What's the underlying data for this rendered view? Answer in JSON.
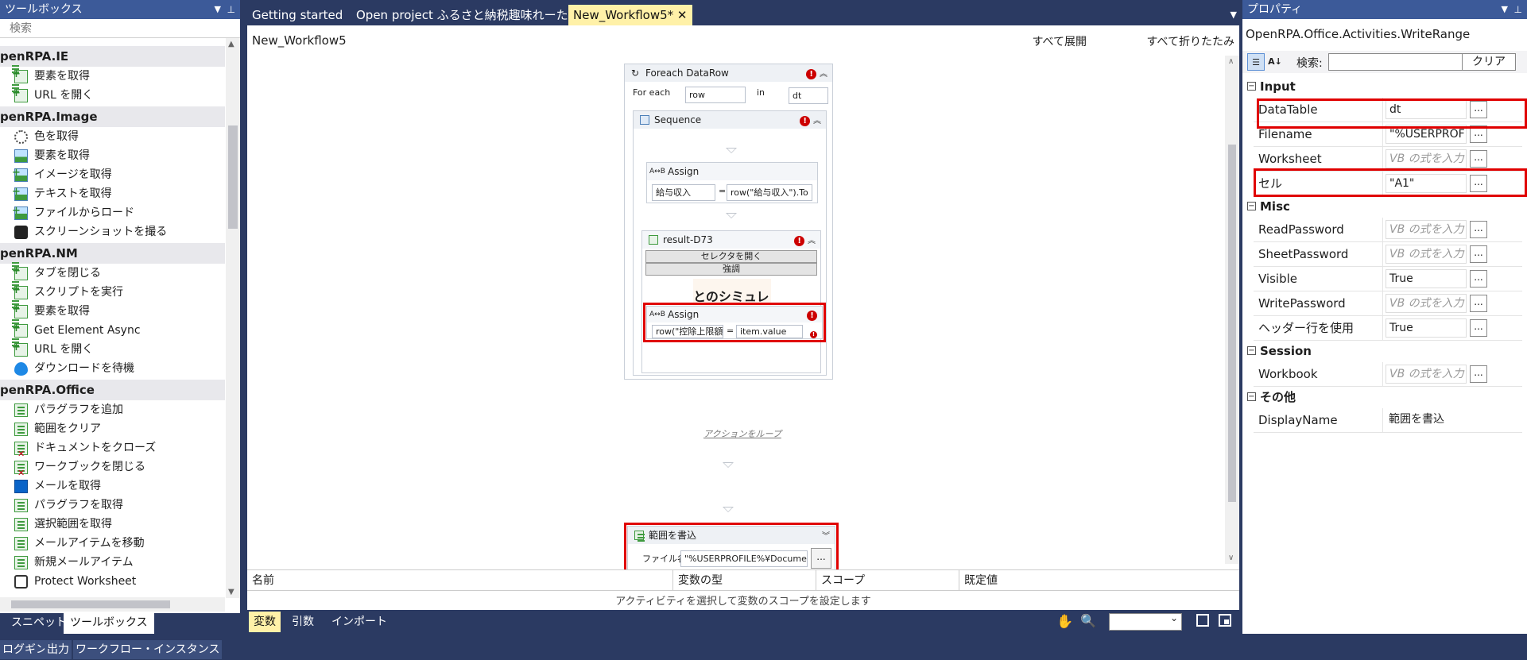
{
  "toolbox": {
    "title": "ツールボックス",
    "search_placeholder": "検索",
    "categories": [
      {
        "name": "penRPA.IE",
        "items": [
          "要素を取得",
          "URL を開く"
        ]
      },
      {
        "name": "penRPA.Image",
        "items": [
          "色を取得",
          "要素を取得",
          "イメージを取得",
          "テキストを取得",
          "ファイルからロード",
          "スクリーンショットを撮る"
        ]
      },
      {
        "name": "penRPA.NM",
        "items": [
          "タブを閉じる",
          "スクリプトを実行",
          "要素を取得",
          "Get Element Async",
          "URL を開く",
          "ダウンロードを待機"
        ]
      },
      {
        "name": "penRPA.Office",
        "items": [
          "パラグラフを追加",
          "範囲をクリア",
          "ドキュメントをクローズ",
          "ワークブックを閉じる",
          "メールを取得",
          "パラグラフを取得",
          "選択範囲を取得",
          "メールアイテムを移動",
          "新規メールアイテム",
          "Protect Worksheet"
        ]
      }
    ],
    "tabs": [
      "スニペット",
      "ツールボックス"
    ]
  },
  "doc_tabs": [
    "Getting started",
    "Open project  ふるさと納税趣味れーた*",
    "New_Workflow5*"
  ],
  "designer": {
    "title": "New_Workflow5",
    "expand_all": "すべて展開",
    "collapse_all": "すべて折りたたみ",
    "foreach": {
      "title": "Foreach DataRow",
      "for_each": "For each",
      "item": "row",
      "in": "in",
      "source": "dt"
    },
    "sequence": {
      "title": "Sequence"
    },
    "assign1": {
      "title": "Assign",
      "to": "給与収入",
      "value": "row(\"給与収入\").To"
    },
    "result": {
      "title": "result-D73",
      "open_selector": "セレクタを開く",
      "highlight": "強調",
      "preview_text": "とのシミュレ"
    },
    "assign2": {
      "title": "Assign",
      "to": "row(\"控除上限額（",
      "value": "item.value"
    },
    "loop_action": "アクションをループ",
    "write_range": {
      "title": "範囲を書込",
      "file_label": "ファイル名",
      "file_value": "\"%USERPROFILE%¥Documents¥"
    }
  },
  "variables": {
    "columns": [
      "名前",
      "変数の型",
      "スコープ",
      "既定値"
    ],
    "hint": "アクティビティを選択して変数のスコープを設定します",
    "tabs": [
      "変数",
      "引数",
      "インポート"
    ]
  },
  "status_tabs": [
    "ログギング",
    "出力",
    "ワークフロー・インスタンス"
  ],
  "properties": {
    "title": "プロパティ",
    "type": "OpenRPA.Office.Activities.WriteRange",
    "search_label": "検索:",
    "clear": "クリア",
    "categories": [
      {
        "name": "Input",
        "rows": [
          {
            "name": "DataTable",
            "value": "dt",
            "placeholder": false,
            "button": true
          },
          {
            "name": "Filename",
            "value": "\"%USERPROFI",
            "placeholder": false,
            "button": true
          },
          {
            "name": "Worksheet",
            "value": "VB の式を入力",
            "placeholder": true,
            "button": true
          },
          {
            "name": "セル",
            "value": "\"A1\"",
            "placeholder": false,
            "button": true
          }
        ]
      },
      {
        "name": "Misc",
        "rows": [
          {
            "name": "ReadPassword",
            "value": "VB の式を入力",
            "placeholder": true,
            "button": true
          },
          {
            "name": "SheetPassword",
            "value": "VB の式を入力",
            "placeholder": true,
            "button": true
          },
          {
            "name": "Visible",
            "value": "True",
            "placeholder": false,
            "button": true
          },
          {
            "name": "WritePassword",
            "value": "VB の式を入力",
            "placeholder": true,
            "button": true
          },
          {
            "name": "ヘッダー行を使用",
            "value": "True",
            "placeholder": false,
            "button": true
          }
        ]
      },
      {
        "name": "Session",
        "rows": [
          {
            "name": "Workbook",
            "value": "VB の式を入力",
            "placeholder": true,
            "button": true
          }
        ]
      },
      {
        "name": "その他",
        "rows": [
          {
            "name": "DisplayName",
            "value": "範囲を書込",
            "placeholder": false,
            "button": false
          }
        ]
      }
    ]
  },
  "colors": {
    "chrome": "#2b3a62",
    "title_bar": "#3c5a99",
    "active_tab": "#fff1a8",
    "highlight": "#e00000",
    "error": "#cc0000"
  }
}
